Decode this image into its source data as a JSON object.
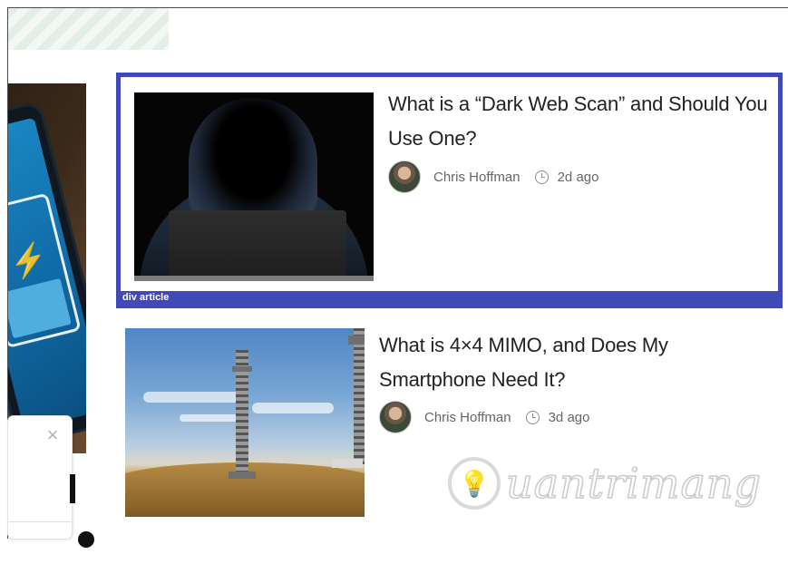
{
  "articles": [
    {
      "title": "What is a “Dark Web Scan” and Should You Use One?",
      "author": "Chris Hoffman",
      "time": "2d ago",
      "highlight_label": "div article"
    },
    {
      "title": "What is 4×4 MIMO, and Does My Smartphone Need It?",
      "author": "Chris Hoffman",
      "time": "3d ago"
    }
  ],
  "popup": {
    "close_glyph": "×"
  },
  "watermark": {
    "text": "uantrimang",
    "icon": "lightbulb-icon"
  },
  "colors": {
    "highlight": "#4149b7",
    "title": "#222222",
    "meta": "#666666"
  }
}
